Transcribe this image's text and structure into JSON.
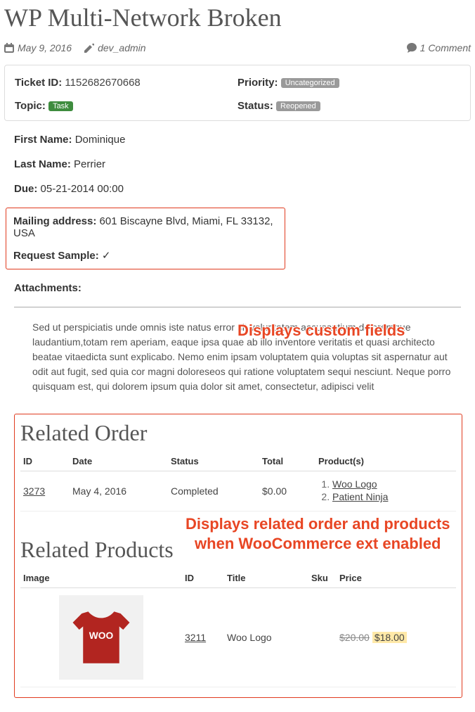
{
  "title": "WP Multi-Network Broken",
  "meta": {
    "date": "May 9, 2016",
    "author": "dev_admin",
    "comments": "1 Comment"
  },
  "ticket": {
    "id_label": "Ticket ID:",
    "id_value": "1152682670668",
    "topic_label": "Topic:",
    "topic_pill": "Task",
    "priority_label": "Priority:",
    "priority_pill": "Uncategorized",
    "status_label": "Status:",
    "status_pill": "Reopened"
  },
  "fields": {
    "first_name_label": "First Name:",
    "first_name_value": "Dominique",
    "last_name_label": "Last Name:",
    "last_name_value": "Perrier",
    "due_label": "Due:",
    "due_value": "05-21-2014 00:00",
    "mailing_label": "Mailing address:",
    "mailing_value": "601 Biscayne Blvd, Miami, FL 33132, USA",
    "sample_label": "Request Sample:",
    "sample_value": "✓",
    "attachments_label": "Attachments:"
  },
  "annotations": {
    "custom_fields": "Displays custom fields",
    "related": "Displays related order and products\nwhen WooCommerce ext enabled"
  },
  "body": "Sed ut perspiciatis unde omnis iste natus error sit voluptatem accusantium doloremque laudantium,totam rem aperiam, eaque ipsa quae ab illo inventore veritatis et quasi architecto beatae vitaedicta sunt explicabo. Nemo enim ipsam voluptatem quia voluptas sit aspernatur aut odit aut fugit, sed quia cor magni doloreseos qui ratione voluptatem sequi nesciunt. Neque porro quisquam est, qui dolorem ipsum quia dolor sit amet, consectetur, adipisci velit",
  "related_order": {
    "heading": "Related Order",
    "cols": {
      "id": "ID",
      "date": "Date",
      "status": "Status",
      "total": "Total",
      "products": "Product(s)"
    },
    "row": {
      "id": "3273",
      "date": "May 4, 2016",
      "status": "Completed",
      "total": "$0.00",
      "products": [
        "Woo Logo",
        "Patient Ninja"
      ]
    }
  },
  "related_products": {
    "heading": "Related Products",
    "cols": {
      "image": "Image",
      "id": "ID",
      "title": "Title",
      "sku": "Sku",
      "price": "Price"
    },
    "row": {
      "logo_text": "WOO",
      "id": "3211",
      "title": "Woo Logo",
      "sku": "",
      "price_old": "$20.00",
      "price_new": "$18.00"
    }
  }
}
